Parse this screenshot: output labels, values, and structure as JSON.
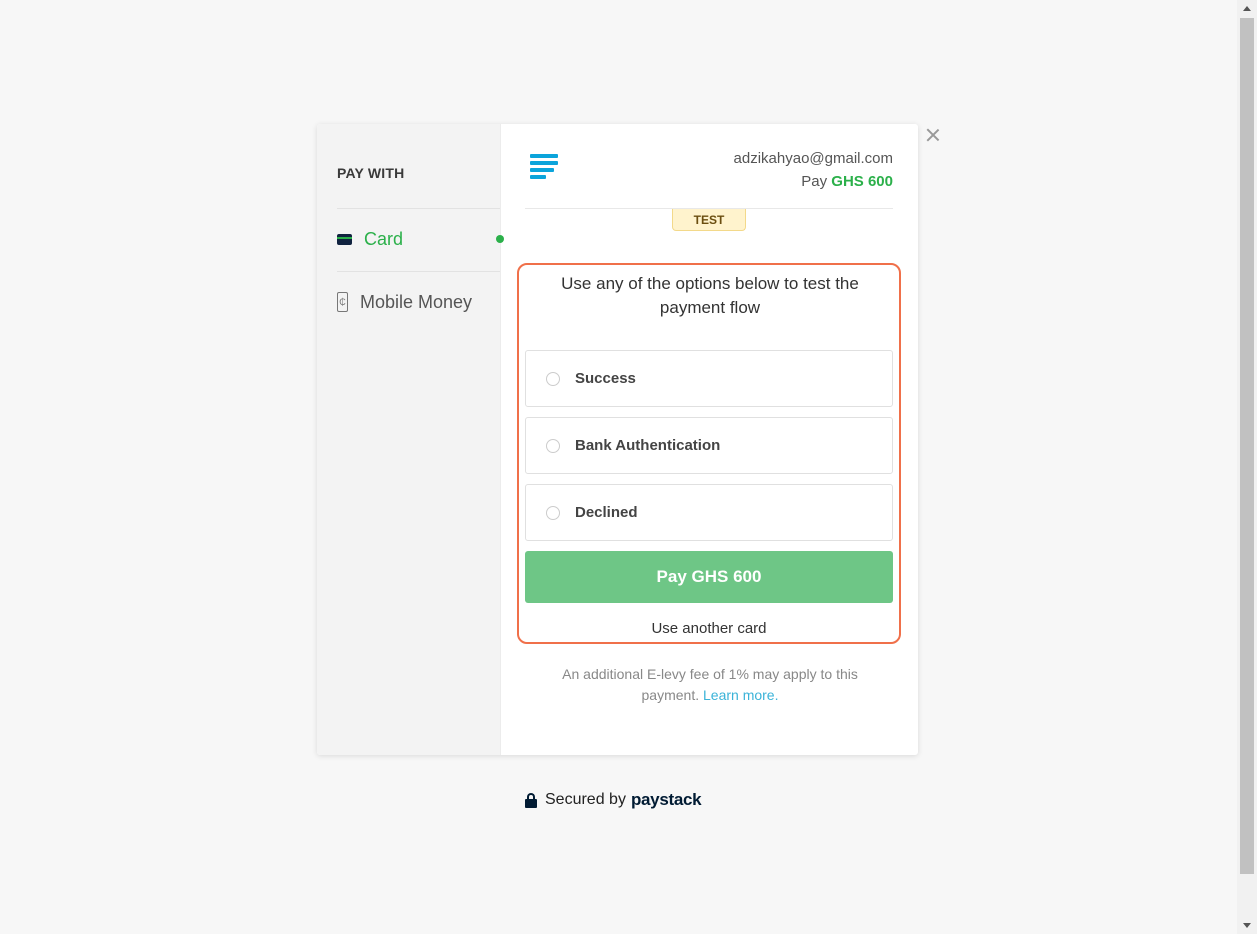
{
  "sidebar": {
    "heading": "PAY WITH",
    "items": [
      {
        "label": "Card",
        "icon": "card-icon",
        "active": true
      },
      {
        "label": "Mobile Money",
        "icon": "phone-icon",
        "active": false
      }
    ],
    "phone_glyph": "₵"
  },
  "header": {
    "email": "adzikahyao@gmail.com",
    "pay_prefix": "Pay",
    "amount": "GHS 600",
    "badge": "TEST"
  },
  "main": {
    "instruction": "Use any of the options below to test the payment flow",
    "options": [
      {
        "label": "Success"
      },
      {
        "label": "Bank Authentication"
      },
      {
        "label": "Declined"
      }
    ],
    "pay_button": "Pay GHS 600",
    "another_card": "Use another card",
    "levy_text": "An additional E-levy fee of 1% may apply to this payment.",
    "learn_more": "Learn more."
  },
  "footer": {
    "secured_by": "Secured by",
    "brand": "paystack"
  },
  "colors": {
    "accent_green": "#2bb04a",
    "button_green": "#6ec686",
    "highlight_border": "#f0704a",
    "link": "#3bb3d8",
    "logo_blue": "#0ba4db"
  }
}
